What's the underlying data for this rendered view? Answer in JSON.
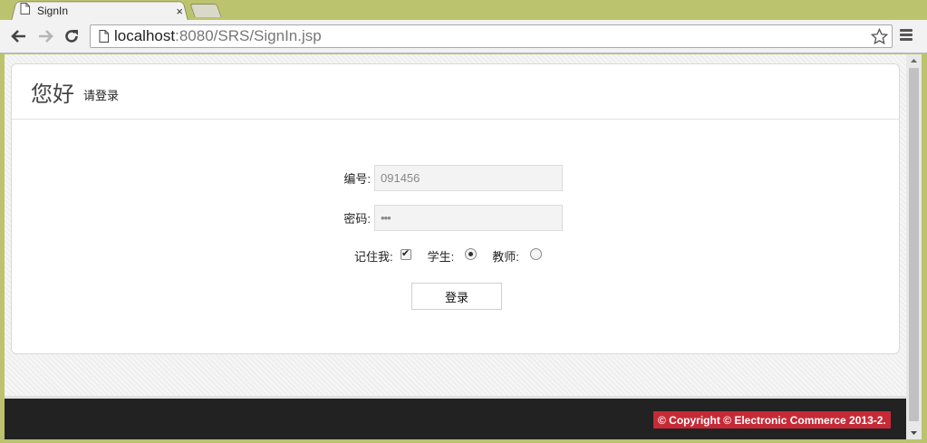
{
  "tab": {
    "title": "SignIn",
    "close": "×"
  },
  "address": {
    "host": "localhost",
    "path": ":8080/SRS/SignIn.jsp"
  },
  "header": {
    "greeting": "您好",
    "subtitle": "请登录"
  },
  "form": {
    "id_label": "编号:",
    "id_value": "091456",
    "password_label": "密码:",
    "password_value": "•••",
    "remember_label": "记住我:",
    "remember_checked": true,
    "student_label": "学生:",
    "student_selected": true,
    "teacher_label": "教师:",
    "teacher_selected": false,
    "login_label": "登录"
  },
  "footer": {
    "copyright": "© Copyright © Electronic Commerce 2013-2."
  },
  "colors": {
    "chrome_frame": "#bcc36e",
    "footer_bg": "#222222",
    "copyright_bg": "#c62a36"
  },
  "icons": [
    "page-icon",
    "back-arrow-icon",
    "forward-arrow-icon",
    "reload-icon",
    "star-icon",
    "menu-icon",
    "checkmark-icon"
  ]
}
